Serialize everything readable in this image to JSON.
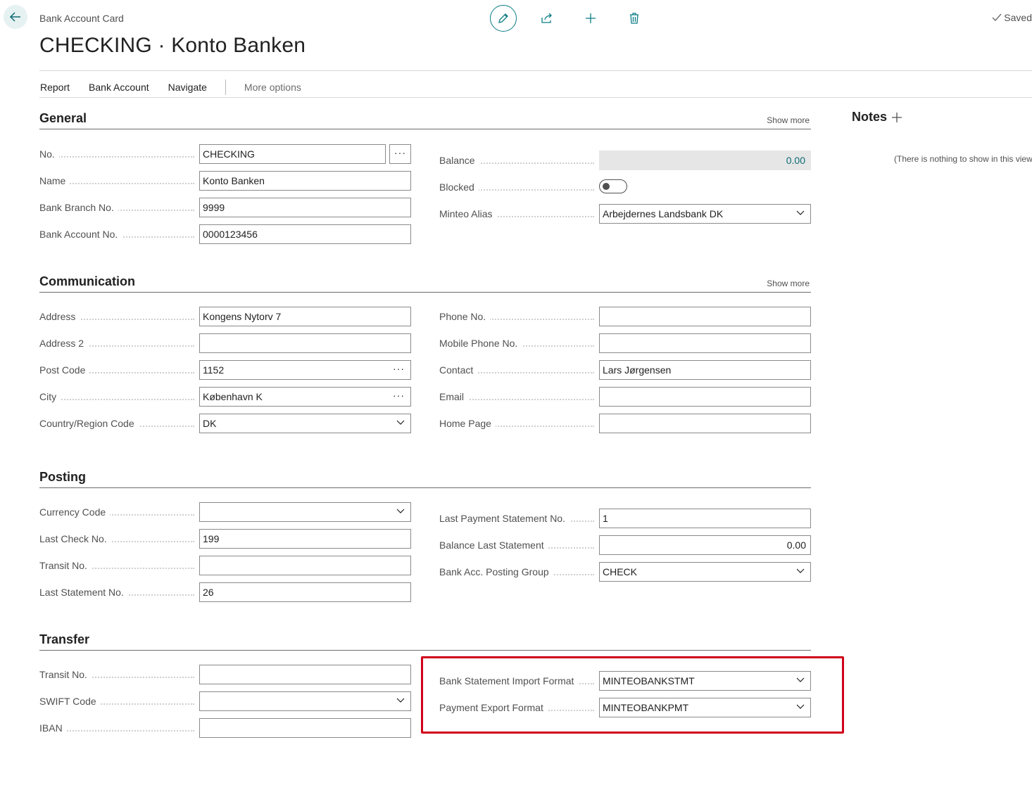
{
  "header": {
    "breadcrumb": "Bank Account Card",
    "title": "CHECKING · Konto Banken",
    "saved": "Saved",
    "icons": [
      "back-arrow-icon",
      "pencil-icon",
      "share-icon",
      "plus-icon",
      "trash-icon",
      "checkmark-icon"
    ]
  },
  "actionbar": {
    "items": [
      "Report",
      "Bank Account",
      "Navigate"
    ],
    "more": "More options"
  },
  "general": {
    "title": "General",
    "show_more": "Show more",
    "no_label": "No.",
    "no_value": "CHECKING",
    "name_label": "Name",
    "name_value": "Konto Banken",
    "branch_label": "Bank Branch No.",
    "branch_value": "9999",
    "account_label": "Bank Account No.",
    "account_value": "0000123456",
    "balance_label": "Balance",
    "balance_value": "0.00",
    "blocked_label": "Blocked",
    "blocked_value": false,
    "alias_label": "Minteo Alias",
    "alias_value": "Arbejdernes Landsbank DK"
  },
  "communication": {
    "title": "Communication",
    "show_more": "Show more",
    "address_label": "Address",
    "address_value": "Kongens Nytorv 7",
    "address2_label": "Address 2",
    "address2_value": "",
    "postcode_label": "Post Code",
    "postcode_value": "1152",
    "city_label": "City",
    "city_value": "København K",
    "country_label": "Country/Region Code",
    "country_value": "DK",
    "phone_label": "Phone No.",
    "phone_value": "",
    "mobile_label": "Mobile Phone No.",
    "mobile_value": "",
    "contact_label": "Contact",
    "contact_value": "Lars Jørgensen",
    "email_label": "Email",
    "email_value": "",
    "homepage_label": "Home Page",
    "homepage_value": ""
  },
  "posting": {
    "title": "Posting",
    "currency_label": "Currency Code",
    "currency_value": "",
    "lastcheck_label": "Last Check No.",
    "lastcheck_value": "199",
    "transit_label": "Transit No.",
    "transit_value": "",
    "laststmt_label": "Last Statement No.",
    "laststmt_value": "26",
    "lastpay_label": "Last Payment Statement No.",
    "lastpay_value": "1",
    "ballast_label": "Balance Last Statement",
    "ballast_value": "0.00",
    "postgroup_label": "Bank Acc. Posting Group",
    "postgroup_value": "CHECK"
  },
  "transfer": {
    "title": "Transfer",
    "transit_label": "Transit No.",
    "transit_value": "",
    "swift_label": "SWIFT Code",
    "swift_value": "",
    "iban_label": "IBAN",
    "iban_value": "",
    "import_label": "Bank Statement Import Format",
    "import_value": "MINTEOBANKSTMT",
    "export_label": "Payment Export Format",
    "export_value": "MINTEOBANKPMT"
  },
  "notes": {
    "title": "Notes",
    "empty": "(There is nothing to show in this view"
  },
  "colors": {
    "accent": "#0b7d84",
    "highlight": "#d0021b"
  }
}
